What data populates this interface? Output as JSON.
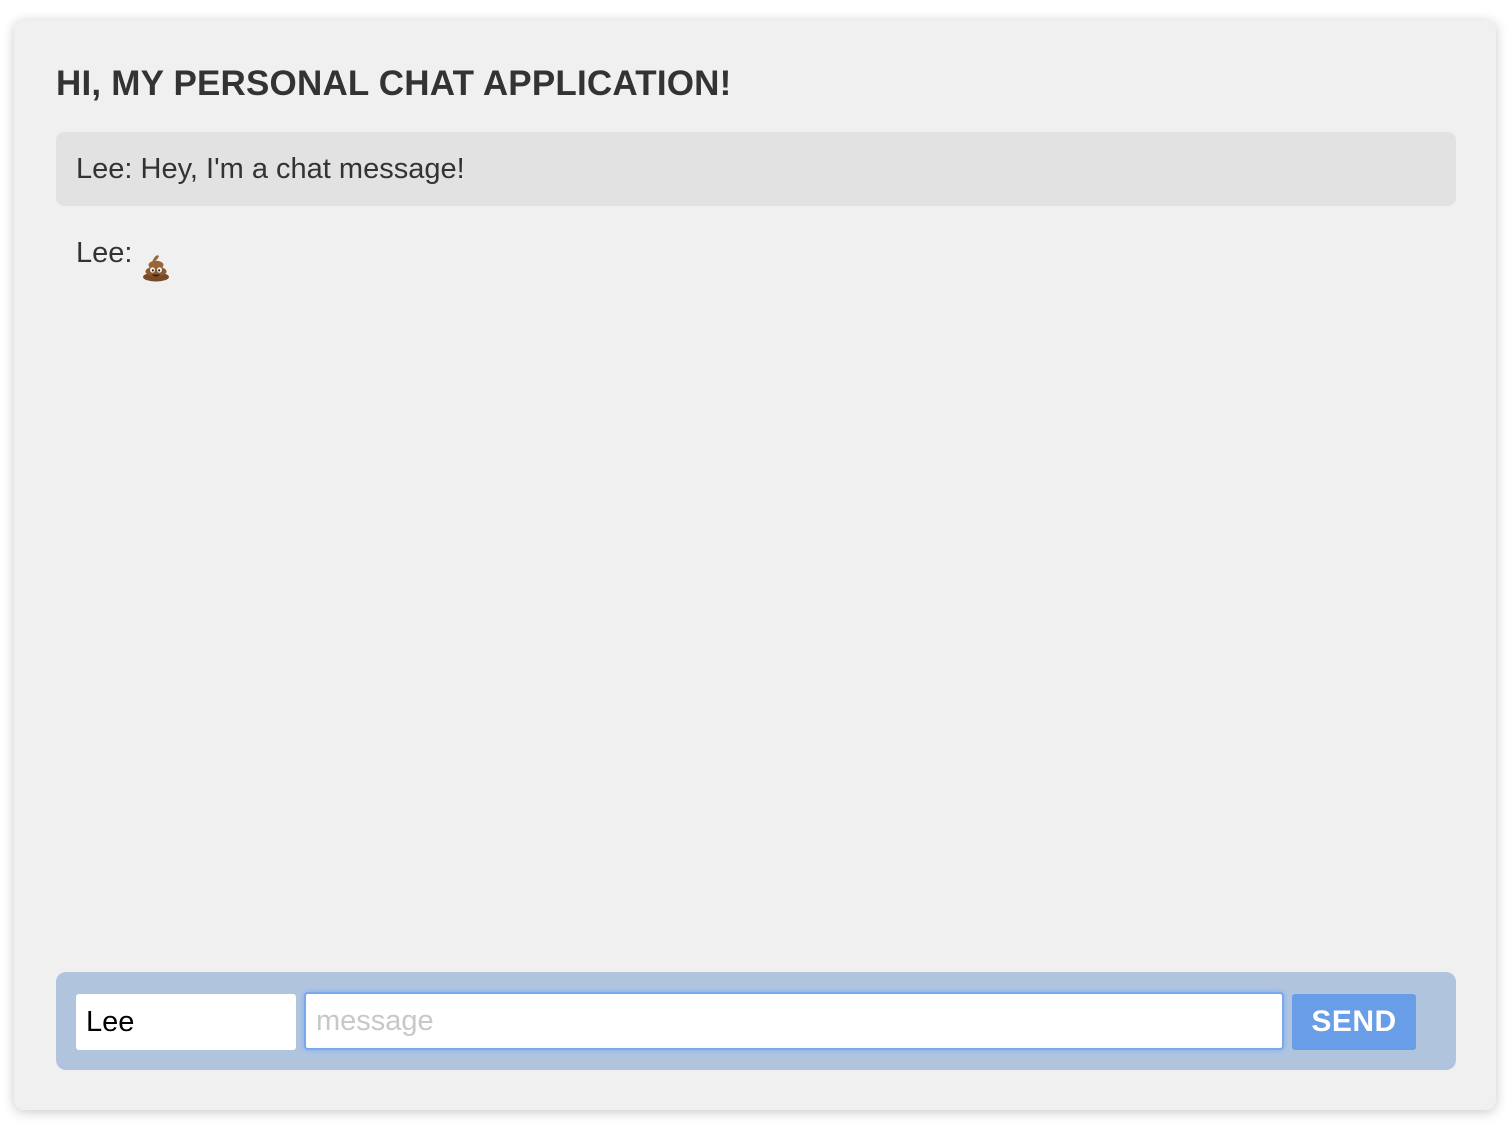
{
  "header": {
    "title": "HI, MY PERSONAL CHAT APPLICATION!"
  },
  "messages": [
    {
      "author": "Lee",
      "text": "Hey, I'm a chat message!",
      "highlighted": true
    },
    {
      "author": "Lee",
      "text": "",
      "icon": "poop-emoji-icon",
      "highlighted": false
    }
  ],
  "composer": {
    "name_value": "Lee",
    "message_placeholder": "message",
    "message_value": "",
    "send_label": "SEND"
  },
  "colors": {
    "window_bg": "#f0f0f0",
    "highlight_row": "#e2e2e2",
    "composer_bg": "#b0c4de",
    "send_button": "#6a9de8",
    "focus_ring": "#7aa9ea",
    "text": "#333333"
  }
}
